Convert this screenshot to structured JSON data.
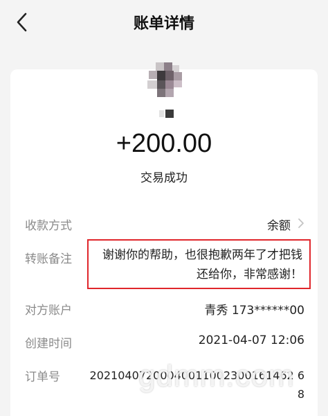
{
  "nav": {
    "title": "账单详情"
  },
  "transaction": {
    "amount": "+200.00",
    "status": "交易成功"
  },
  "details": {
    "payment_method_label": "收款方式",
    "payment_method_value": "余额",
    "note_label": "转账备注",
    "note_value": "谢谢你的帮助，也很抱歉两年了才把钱还给你，非常感谢！",
    "counterparty_label": "对方账户",
    "counterparty_value": "青秀 173******00",
    "created_label": "创建时间",
    "created_value": "2021-04-07 12:06",
    "order_label": "订单号",
    "order_value": "20210407200040011002300161462 68"
  },
  "watermark": "gdmm.com",
  "colors": {
    "background": "#f4f4f4",
    "card": "#ffffff",
    "highlight_border": "#e0262b",
    "label": "#8a8a8a"
  },
  "icons": {
    "back": "chevron-left-icon",
    "row_arrow": "chevron-right-icon"
  }
}
